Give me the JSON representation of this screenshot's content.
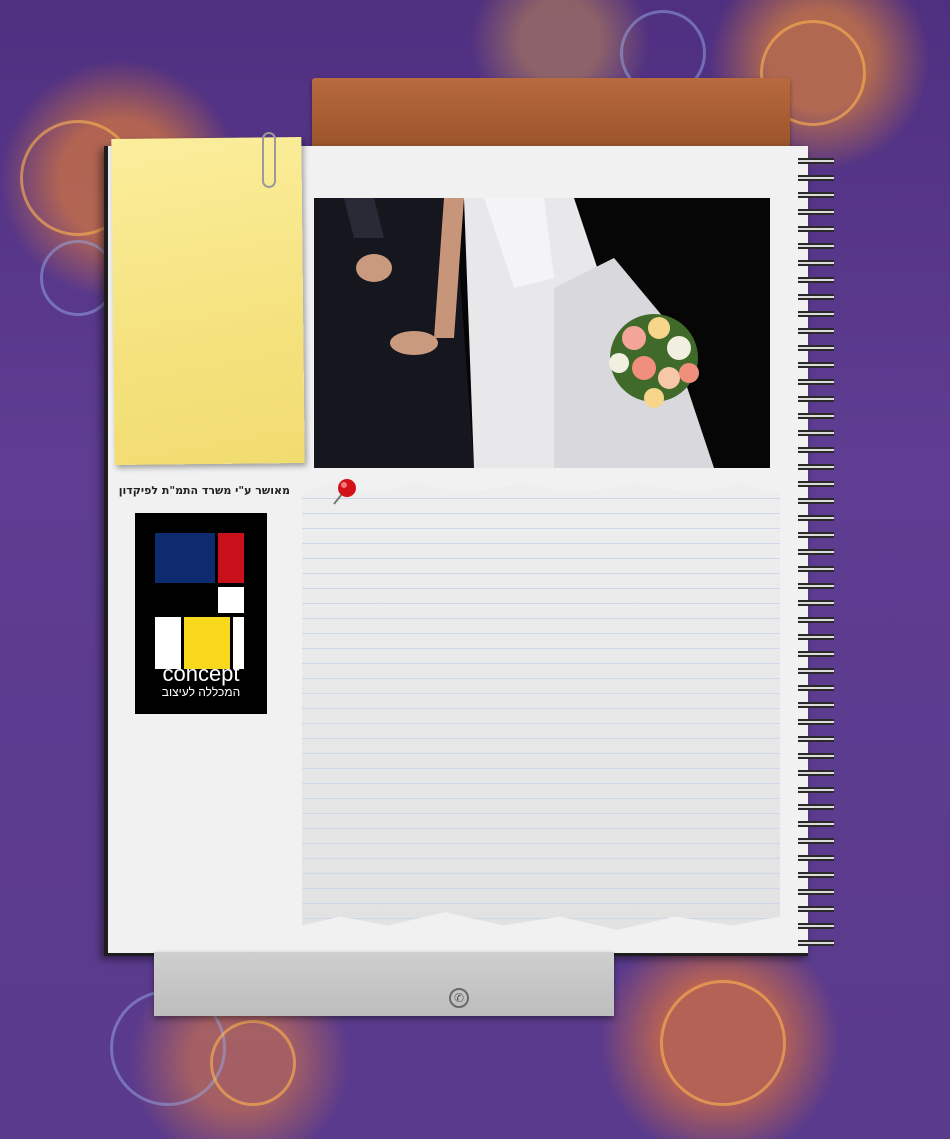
{
  "sidebar": {
    "approval_text": "מאושר  ע\"י משרד התמ\"ת לפיקדון"
  },
  "logo": {
    "word": "concept",
    "tagline": "המכללה לעיצוב",
    "colors": {
      "blue": "#0d2b6e",
      "red": "#c8101a",
      "yellow": "#f8d81c",
      "white": "#ffffff",
      "black": "#000000"
    }
  },
  "icons": {
    "footer_phone": "phone-icon",
    "note_pin": "pushpin-icon",
    "note_clip": "paperclip-icon"
  }
}
